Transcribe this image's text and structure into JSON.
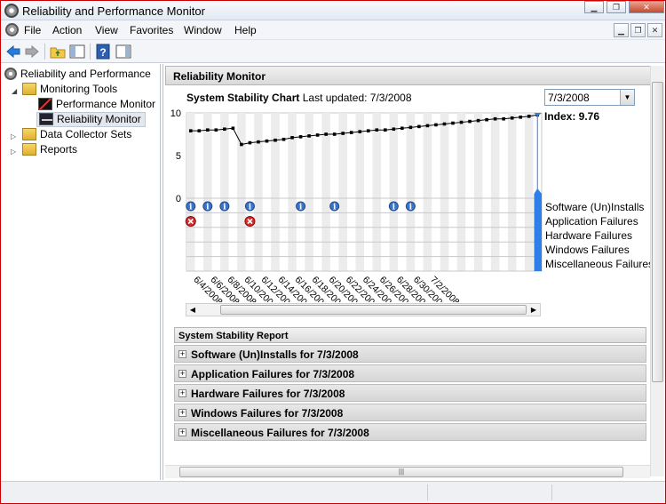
{
  "window": {
    "title": "Reliability and Performance Monitor"
  },
  "menu": [
    "File",
    "Action",
    "View",
    "Favorites",
    "Window",
    "Help"
  ],
  "tree": {
    "root": "Reliability and Performance",
    "monitoring_tools": "Monitoring Tools",
    "performance_monitor": "Performance Monitor",
    "reliability_monitor": "Reliability Monitor",
    "data_collector_sets": "Data Collector Sets",
    "reports": "Reports"
  },
  "content": {
    "section_title": "Reliability Monitor",
    "chart_title": "System Stability Chart",
    "last_updated": "Last updated: 7/3/2008",
    "date_select": "7/3/2008",
    "index": "Index: 9.76"
  },
  "chart_data": {
    "type": "line",
    "title": "System Stability Chart",
    "ylim": [
      0,
      10
    ],
    "yticks": [
      "10",
      "5",
      "0"
    ],
    "x_labels": [
      "6/4/2008",
      "6/6/2008",
      "6/8/2008",
      "6/10/2008",
      "6/12/2008",
      "6/14/2008",
      "6/16/2008",
      "6/18/2008",
      "6/20/2008",
      "6/22/2008",
      "6/24/2008",
      "6/26/2008",
      "6/28/2008",
      "6/30/2008",
      "7/2/2008"
    ],
    "values": [
      7.9,
      7.9,
      8.0,
      8.0,
      8.1,
      8.2,
      6.3,
      6.5,
      6.6,
      6.7,
      6.8,
      6.9,
      7.1,
      7.2,
      7.3,
      7.4,
      7.5,
      7.5,
      7.6,
      7.7,
      7.8,
      7.9,
      8.0,
      8.0,
      8.1,
      8.2,
      8.3,
      8.4,
      8.5,
      8.6,
      8.7,
      8.8,
      8.9,
      9.0,
      9.1,
      9.2,
      9.3,
      9.3,
      9.4,
      9.5,
      9.6,
      9.76
    ],
    "row_labels": [
      "Software (Un)Installs",
      "Application Failures",
      "Hardware Failures",
      "Windows Failures",
      "Miscellaneous Failures"
    ],
    "info_events_day_index": [
      0,
      2,
      4,
      7,
      13,
      17,
      24,
      26
    ],
    "failure_events_day_index": [
      0,
      7
    ],
    "colors": {
      "selection": "#2f7fe8",
      "line": "#000000",
      "band": "#ececec"
    }
  },
  "report": {
    "header": "System Stability Report",
    "rows": [
      "Software (Un)Installs for 7/3/2008",
      "Application Failures for 7/3/2008",
      "Hardware Failures for 7/3/2008",
      "Windows Failures for 7/3/2008",
      "Miscellaneous Failures for 7/3/2008"
    ]
  }
}
